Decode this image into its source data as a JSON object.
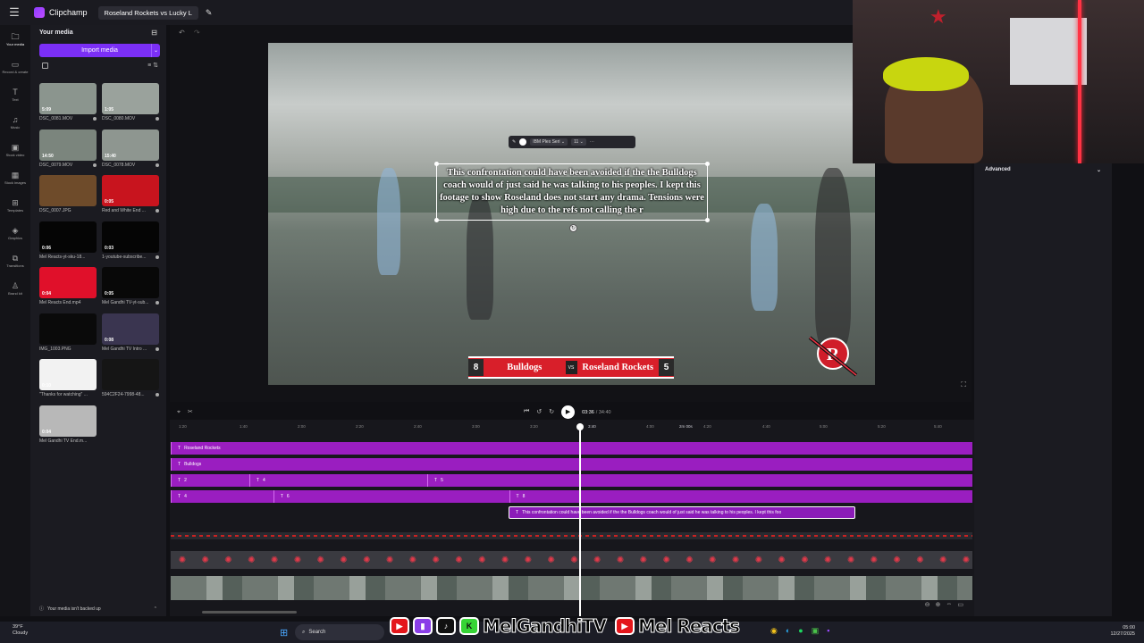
{
  "app": {
    "name": "Clipchamp",
    "project_title": "Roseland Rockets vs Lucky L"
  },
  "rail": [
    {
      "icon": "folder-icon",
      "glyph": "🗀",
      "label": "Your media"
    },
    {
      "icon": "record-icon",
      "glyph": "▭",
      "label": "Record & create"
    },
    {
      "icon": "text-icon",
      "glyph": "T",
      "label": "Text"
    },
    {
      "icon": "music-icon",
      "glyph": "♫",
      "label": "Music"
    },
    {
      "icon": "stock-video-icon",
      "glyph": "▣",
      "label": "Stock video"
    },
    {
      "icon": "stock-images-icon",
      "glyph": "▦",
      "label": "Stock images"
    },
    {
      "icon": "templates-icon",
      "glyph": "⊞",
      "label": "Templates"
    },
    {
      "icon": "graphics-icon",
      "glyph": "◈",
      "label": "Graphics"
    },
    {
      "icon": "transitions-icon",
      "glyph": "⧉",
      "label": "Transitions"
    },
    {
      "icon": "brand-kit-icon",
      "glyph": "♙",
      "label": "Brand kit"
    }
  ],
  "media": {
    "header": "Your media",
    "import_label": "Import media",
    "items": [
      {
        "name": "DSC_0081.MOV",
        "duration": "5:09",
        "bg": "#8b958e"
      },
      {
        "name": "DSC_0080.MOV",
        "duration": "1:05",
        "bg": "#9aa29c"
      },
      {
        "name": "DSC_0079.MOV",
        "duration": "14:50",
        "bg": "#7b857d"
      },
      {
        "name": "DSC_0078.MOV",
        "duration": "15:40",
        "bg": "#8e9690"
      },
      {
        "name": "DSC_0007.JPG",
        "duration": "",
        "bg": "#6e4b2a"
      },
      {
        "name": "Red and White End ...",
        "duration": "0:05",
        "bg": "#c8141e"
      },
      {
        "name": "Mel Reacts-yt-sku-18...",
        "duration": "0:06",
        "bg": "#050505"
      },
      {
        "name": "1-youtube-subscribe...",
        "duration": "0:03",
        "bg": "#050505"
      },
      {
        "name": "Mel Reacts End.mp4",
        "duration": "0:04",
        "bg": "#e0102a"
      },
      {
        "name": "Mel Gandhi TV-yt-sub...",
        "duration": "0:05",
        "bg": "#080808"
      },
      {
        "name": "IMG_1003.PNG",
        "duration": "",
        "bg": "#0a0a0a"
      },
      {
        "name": "Mel Gandhi TV Intro ...",
        "duration": "0:08",
        "bg": "#3a3550"
      },
      {
        "name": "\"Thanks for watching\" ...",
        "duration": "0:10",
        "bg": "#f2f2f2"
      },
      {
        "name": "594C2F24-7998-48...",
        "duration": "",
        "bg": "#151515"
      },
      {
        "name": "Mel Gandhi TV End.m...",
        "duration": "0:04",
        "bg": "#b8b8b8"
      }
    ],
    "backup_text": "Your media isn't backed up"
  },
  "preview": {
    "caption": "This confrontation could have been avoided if the the Bulldogs coach would of just said he was talking to his peoples. I kept this footage to show Roseland does not start any drama. Tensions were high due to the refs not calling the r",
    "font": "IBM Plex Seri",
    "font_size": "11",
    "score": {
      "home": "8",
      "home_team": "Bulldogs",
      "vs": "VS",
      "away_team": "Roseland Rockets",
      "away": "5"
    }
  },
  "properties": {
    "header": "Advanced"
  },
  "playback": {
    "current": "03:36",
    "total": "/ 34:40"
  },
  "ruler": [
    {
      "t": "1:20",
      "h": false
    },
    {
      "t": "1:40",
      "h": false
    },
    {
      "t": "2:00",
      "h": false
    },
    {
      "t": "2:20",
      "h": false
    },
    {
      "t": "2:40",
      "h": false
    },
    {
      "t": "3:00",
      "h": false
    },
    {
      "t": "3:20",
      "h": false
    },
    {
      "t": "3:40",
      "h": true
    },
    {
      "t": "4:00",
      "h": false
    },
    {
      "t": "2m 00s",
      "h": true
    },
    {
      "t": "4:20",
      "h": false
    },
    {
      "t": "4:40",
      "h": false
    },
    {
      "t": "5:00",
      "h": false
    },
    {
      "t": "5:20",
      "h": false
    },
    {
      "t": "5:40",
      "h": false
    }
  ],
  "tracks": [
    {
      "clips": [
        {
          "label": "Roseland Rockets",
          "start": 0,
          "end": 1.0
        }
      ]
    },
    {
      "clips": [
        {
          "label": "Bulldogs",
          "start": 0,
          "end": 1.0
        }
      ]
    },
    {
      "clips": [
        {
          "label": "2",
          "start": 0,
          "end": 0.098
        },
        {
          "label": "4",
          "start": 0.098,
          "end": 0.32
        },
        {
          "label": "5",
          "start": 0.32,
          "end": 1.0
        }
      ]
    },
    {
      "clips": [
        {
          "label": "4",
          "start": 0,
          "end": 0.128
        },
        {
          "label": "6",
          "start": 0.128,
          "end": 0.422
        },
        {
          "label": "8",
          "start": 0.422,
          "end": 1.0
        }
      ]
    }
  ],
  "selected_clip": {
    "label": "This confrontation could have been avoided if the the Bulldogs coach would of just said he was talking to his peoples. I kept this foo"
  },
  "taskbar": {
    "temp": "39°F",
    "weather": "Cloudy",
    "search": "Search",
    "time": "05:00",
    "date": "12/27/2025"
  },
  "overlay_banner": {
    "name1": "MelGandhiTV",
    "name2": "Mel Reacts"
  }
}
